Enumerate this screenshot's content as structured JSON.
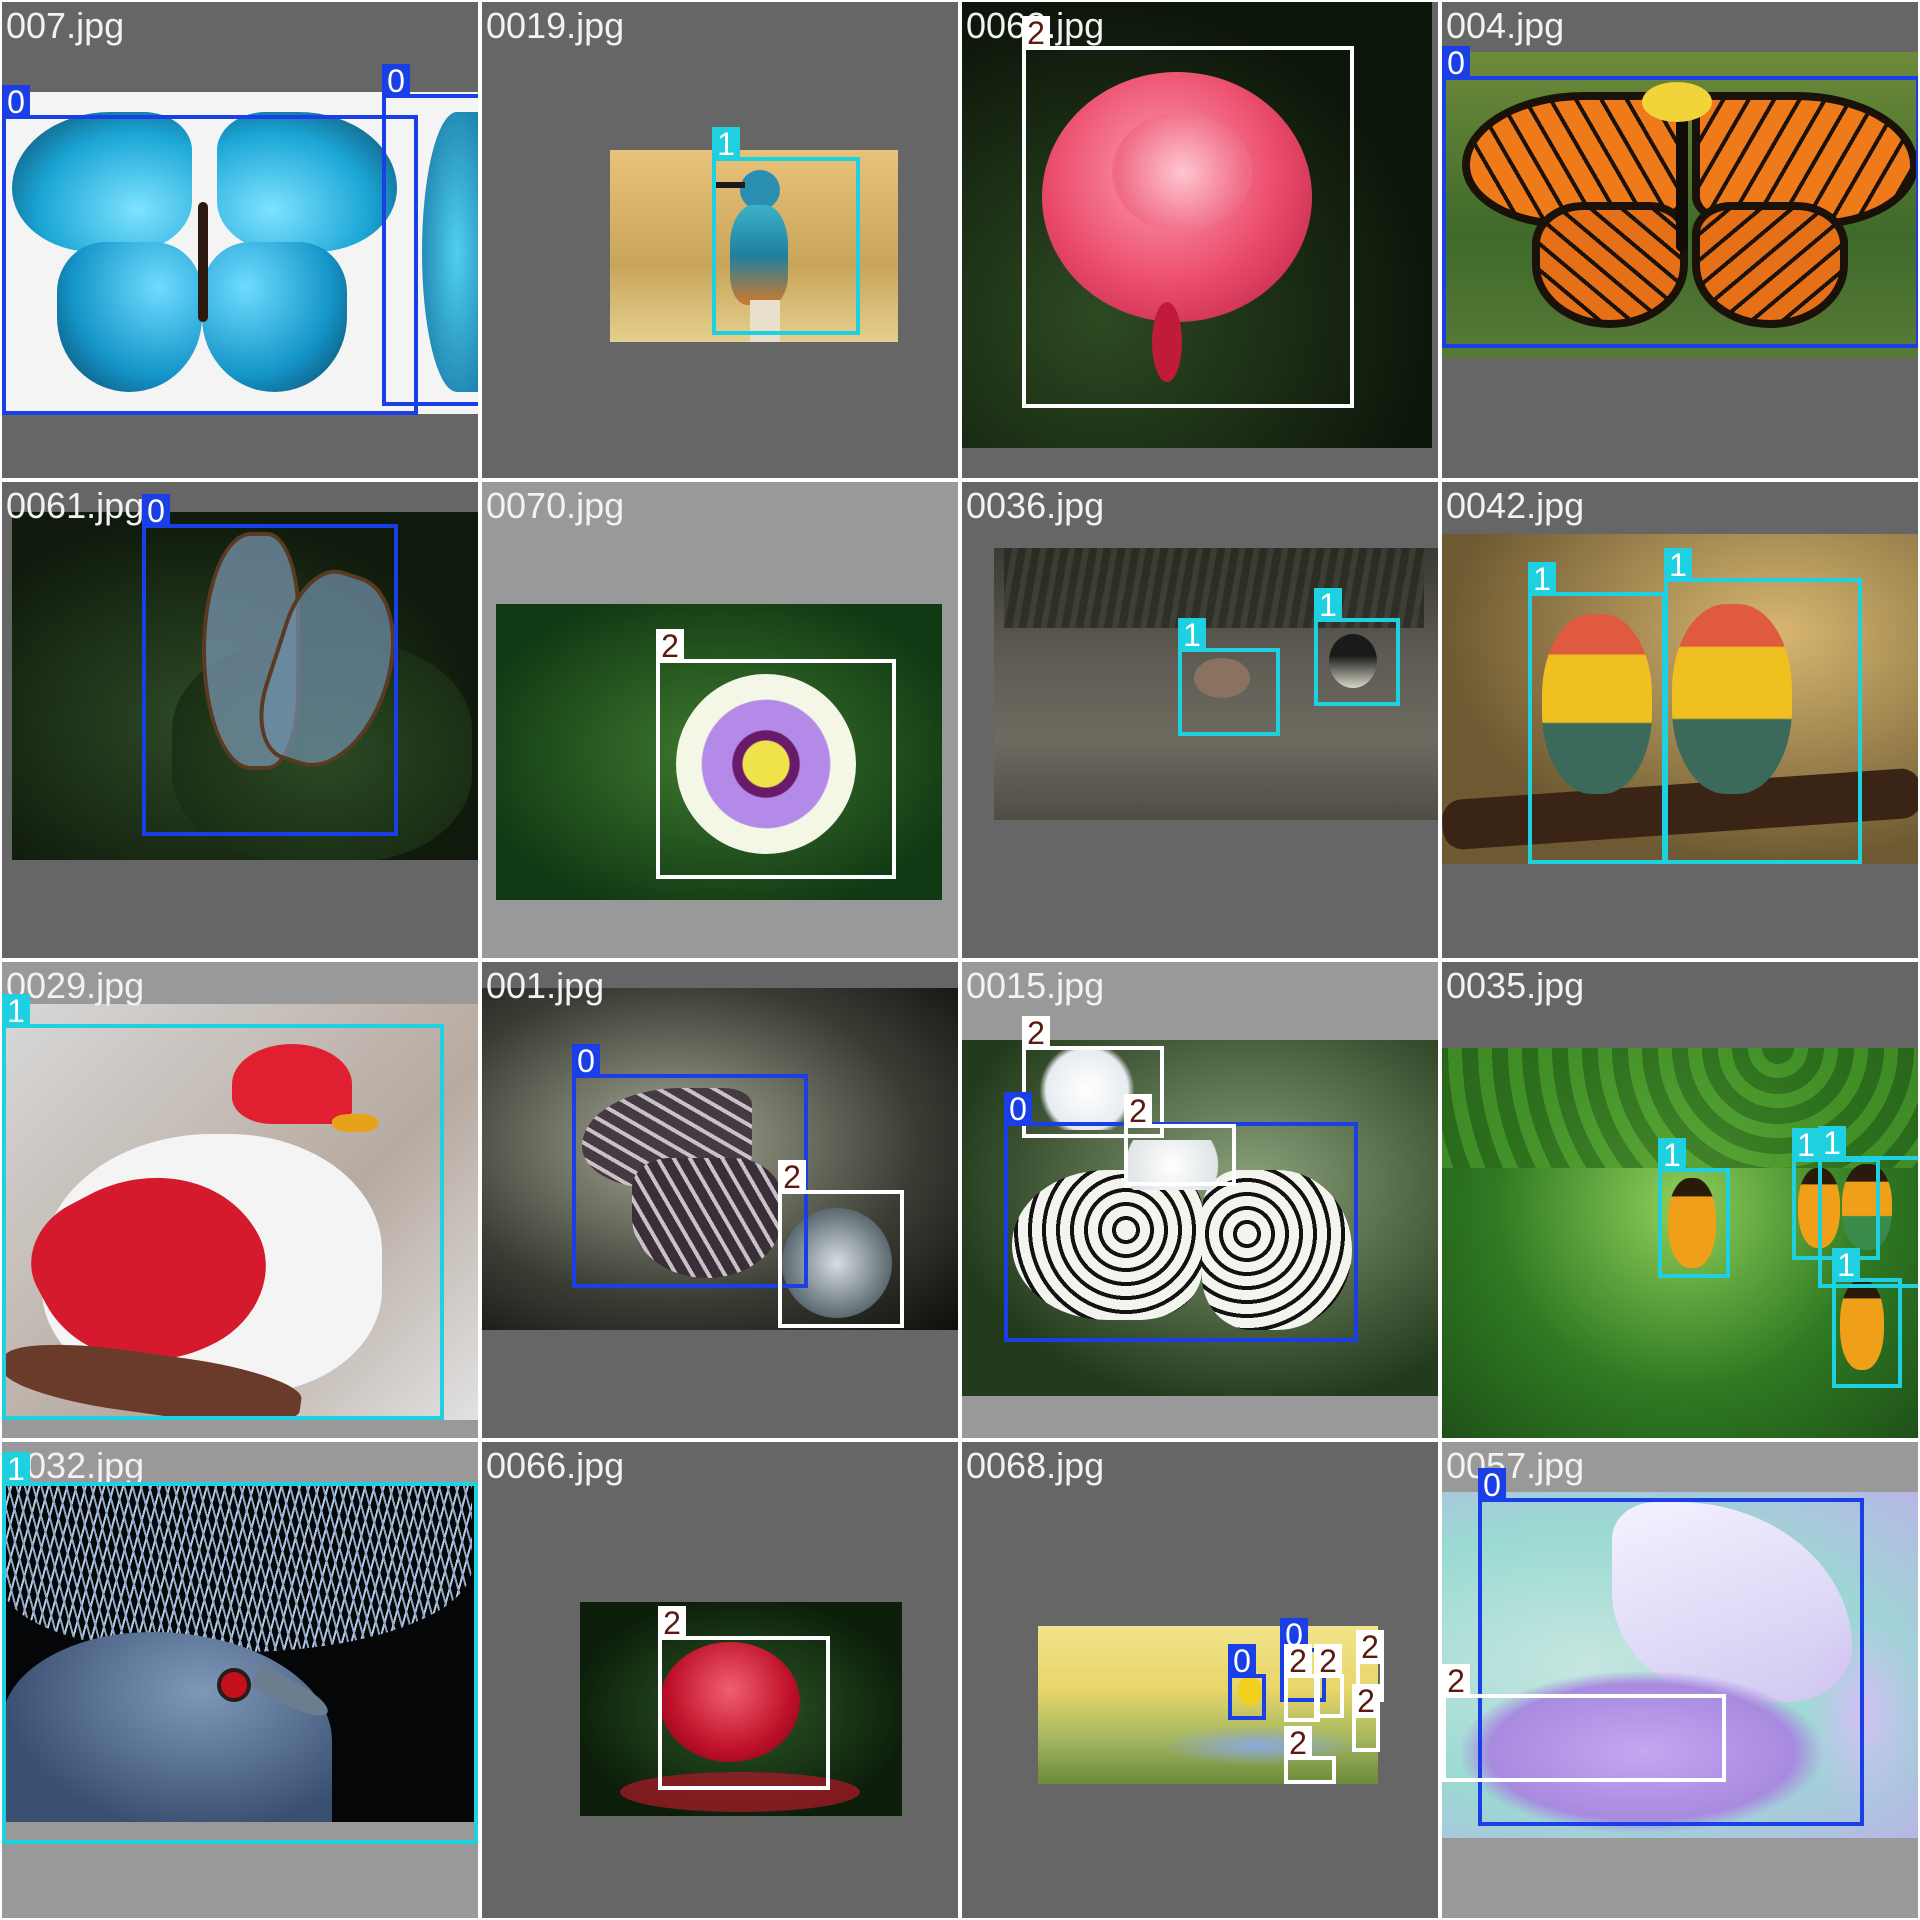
{
  "title": "",
  "colors": {
    "class0": "#1a3fe6",
    "class1": "#1fd0e0",
    "class2": "#ffffff",
    "label0_text": "#ffffff",
    "label1_text": "#ffffff",
    "label2_text": "#5a1a10"
  },
  "tiles": [
    {
      "filename": "007.jpg",
      "boxes": [
        {
          "cls": "0"
        },
        {
          "cls": "0"
        }
      ]
    },
    {
      "filename": "0019.jpg",
      "boxes": [
        {
          "cls": "1"
        }
      ]
    },
    {
      "filename": "0062.jpg",
      "boxes": [
        {
          "cls": "2"
        }
      ]
    },
    {
      "filename": "004.jpg",
      "boxes": [
        {
          "cls": "0"
        }
      ]
    },
    {
      "filename": "0061.jpg",
      "boxes": [
        {
          "cls": "0"
        }
      ]
    },
    {
      "filename": "0070.jpg",
      "boxes": [
        {
          "cls": "2"
        }
      ]
    },
    {
      "filename": "0036.jpg",
      "boxes": [
        {
          "cls": "1"
        },
        {
          "cls": "1"
        }
      ]
    },
    {
      "filename": "0042.jpg",
      "boxes": [
        {
          "cls": "1"
        },
        {
          "cls": "1"
        }
      ]
    },
    {
      "filename": "0029.jpg",
      "boxes": [
        {
          "cls": "1"
        }
      ]
    },
    {
      "filename": "001.jpg",
      "boxes": [
        {
          "cls": "0"
        },
        {
          "cls": "2"
        }
      ]
    },
    {
      "filename": "0015.jpg",
      "boxes": [
        {
          "cls": "2"
        },
        {
          "cls": "0"
        },
        {
          "cls": "2"
        }
      ]
    },
    {
      "filename": "0035.jpg",
      "boxes": [
        {
          "cls": "1"
        },
        {
          "cls": "1"
        },
        {
          "cls": "1"
        },
        {
          "cls": "1"
        }
      ]
    },
    {
      "filename": "0032.jpg",
      "boxes": [
        {
          "cls": "1"
        }
      ]
    },
    {
      "filename": "0066.jpg",
      "boxes": [
        {
          "cls": "2"
        }
      ]
    },
    {
      "filename": "0068.jpg",
      "boxes": [
        {
          "cls": "0"
        },
        {
          "cls": "0"
        },
        {
          "cls": "2"
        },
        {
          "cls": "2"
        },
        {
          "cls": "2"
        },
        {
          "cls": "2"
        },
        {
          "cls": "2"
        }
      ]
    },
    {
      "filename": "0057.jpg",
      "boxes": [
        {
          "cls": "0"
        },
        {
          "cls": "2"
        }
      ]
    }
  ]
}
